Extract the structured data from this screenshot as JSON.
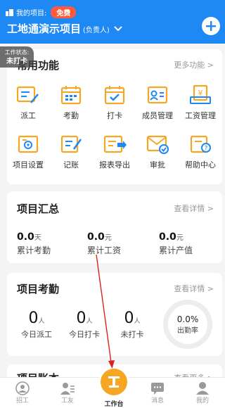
{
  "header": {
    "project_prefix": "我的项目:",
    "free_badge": "免费",
    "project_name": "工地通演示项目",
    "project_role": "(负责人)",
    "bg_color": "#1e88f5"
  },
  "status_tag": {
    "line1": "工作状态:",
    "line2": "未打卡"
  },
  "common_functions": {
    "title": "常用功能",
    "more": "更多功能 >",
    "items": [
      {
        "label": "派工",
        "icon": "dispatch-icon"
      },
      {
        "label": "考勤",
        "icon": "attendance-calendar-icon"
      },
      {
        "label": "打卡",
        "icon": "clock-in-icon"
      },
      {
        "label": "成员管理",
        "icon": "member-management-icon"
      },
      {
        "label": "工资管理",
        "icon": "salary-management-icon"
      },
      {
        "label": "项目设置",
        "icon": "project-settings-icon"
      },
      {
        "label": "记账",
        "icon": "bookkeeping-icon"
      },
      {
        "label": "报表导出",
        "icon": "report-export-icon"
      },
      {
        "label": "审批",
        "icon": "approval-icon"
      },
      {
        "label": "帮助中心",
        "icon": "help-center-icon"
      }
    ]
  },
  "summary": {
    "title": "项目汇总",
    "more": "查看详情 >",
    "stats": [
      {
        "value": "0.0",
        "unit": "天",
        "label": "累计考勤"
      },
      {
        "value": "0.0",
        "unit": "元",
        "label": "累计工资"
      },
      {
        "value": "0.0",
        "unit": "元",
        "label": "累计产值"
      }
    ]
  },
  "attendance": {
    "title": "项目考勤",
    "more": "查看详情 >",
    "stats": [
      {
        "value": "0",
        "unit": "人",
        "label": "今日派工"
      },
      {
        "value": "0",
        "unit": "人",
        "label": "今日打卡"
      },
      {
        "value": "0",
        "unit": "人",
        "label": "未打卡"
      }
    ],
    "rate_value": "0.0%",
    "rate_label": "出勤率"
  },
  "ledger": {
    "title": "项目账本",
    "more": "查看更多 >"
  },
  "tabbar": {
    "tabs": [
      {
        "label": "招工",
        "icon": "recruit-icon"
      },
      {
        "label": "工友",
        "icon": "workmates-icon"
      },
      {
        "label": "工作台",
        "icon": "workbench-icon"
      },
      {
        "label": "消息",
        "icon": "message-icon"
      },
      {
        "label": "我的",
        "icon": "profile-icon"
      }
    ],
    "accent": "#f5a623"
  }
}
